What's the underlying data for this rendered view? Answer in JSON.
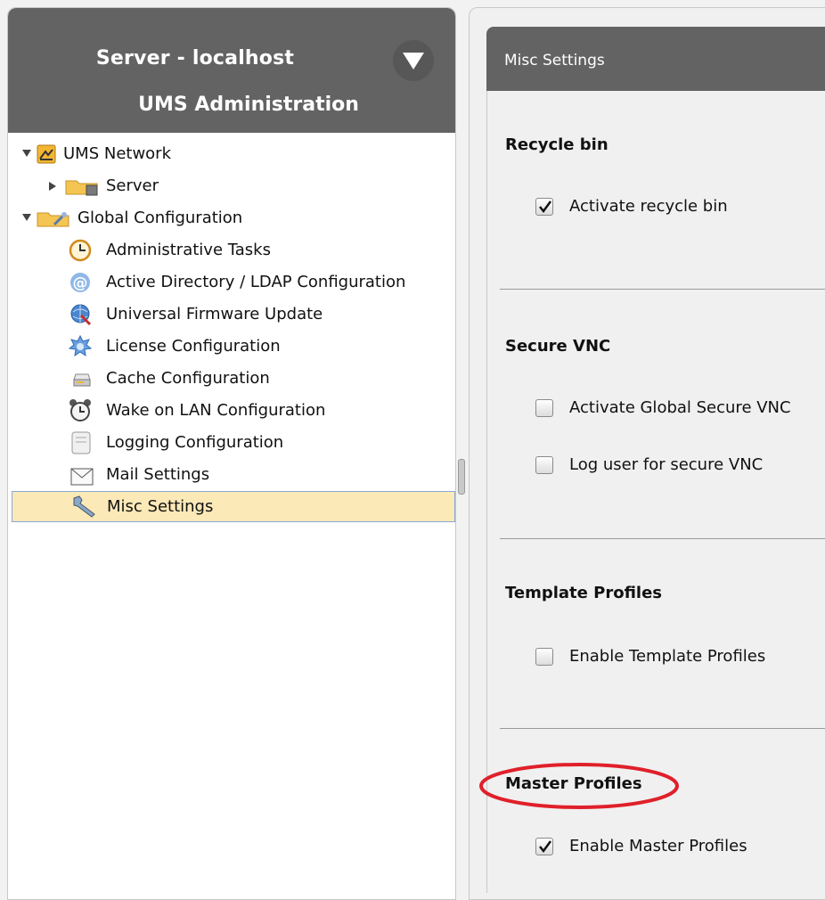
{
  "left": {
    "server_title": "Server - localhost",
    "admin_title": "UMS Administration",
    "tree": [
      {
        "label": "UMS Network",
        "icon": "ums-network-icon",
        "level": 0,
        "expander": "down"
      },
      {
        "label": "Server",
        "icon": "server-folder-icon",
        "level": 1,
        "expander": "right"
      },
      {
        "label": "Global Configuration",
        "icon": "global-config-folder-icon",
        "level": 0,
        "expander": "down"
      },
      {
        "label": "Administrative Tasks",
        "icon": "clock-icon",
        "level": 2
      },
      {
        "label": "Active Directory / LDAP Configuration",
        "icon": "at-sign-icon",
        "level": 2
      },
      {
        "label": "Universal Firmware Update",
        "icon": "globe-update-icon",
        "level": 2
      },
      {
        "label": "License Configuration",
        "icon": "license-gear-icon",
        "level": 2
      },
      {
        "label": "Cache Configuration",
        "icon": "cache-icon",
        "level": 2
      },
      {
        "label": "Wake on LAN Configuration",
        "icon": "alarm-clock-icon",
        "level": 2
      },
      {
        "label": "Logging Configuration",
        "icon": "log-file-icon",
        "level": 2
      },
      {
        "label": "Mail Settings",
        "icon": "envelope-icon",
        "level": 2
      },
      {
        "label": "Misc Settings",
        "icon": "wrench-icon",
        "level": 2,
        "selected": true
      }
    ]
  },
  "right": {
    "title": "Misc Settings",
    "sections": [
      {
        "title": "Recycle bin",
        "options": [
          {
            "label": "Activate recycle bin",
            "checked": true
          }
        ]
      },
      {
        "title": "Secure VNC",
        "options": [
          {
            "label": "Activate Global Secure VNC",
            "checked": false
          },
          {
            "label": "Log user for secure VNC",
            "checked": false
          }
        ]
      },
      {
        "title": "Template Profiles",
        "options": [
          {
            "label": "Enable Template Profiles",
            "checked": false
          }
        ]
      },
      {
        "title": "Master Profiles",
        "options": [
          {
            "label": "Enable Master Profiles",
            "checked": true
          }
        ]
      }
    ]
  },
  "colors": {
    "header_bg": "#636363",
    "selection_bg": "#fce9b8",
    "highlight_ellipse": "#e0202a"
  }
}
